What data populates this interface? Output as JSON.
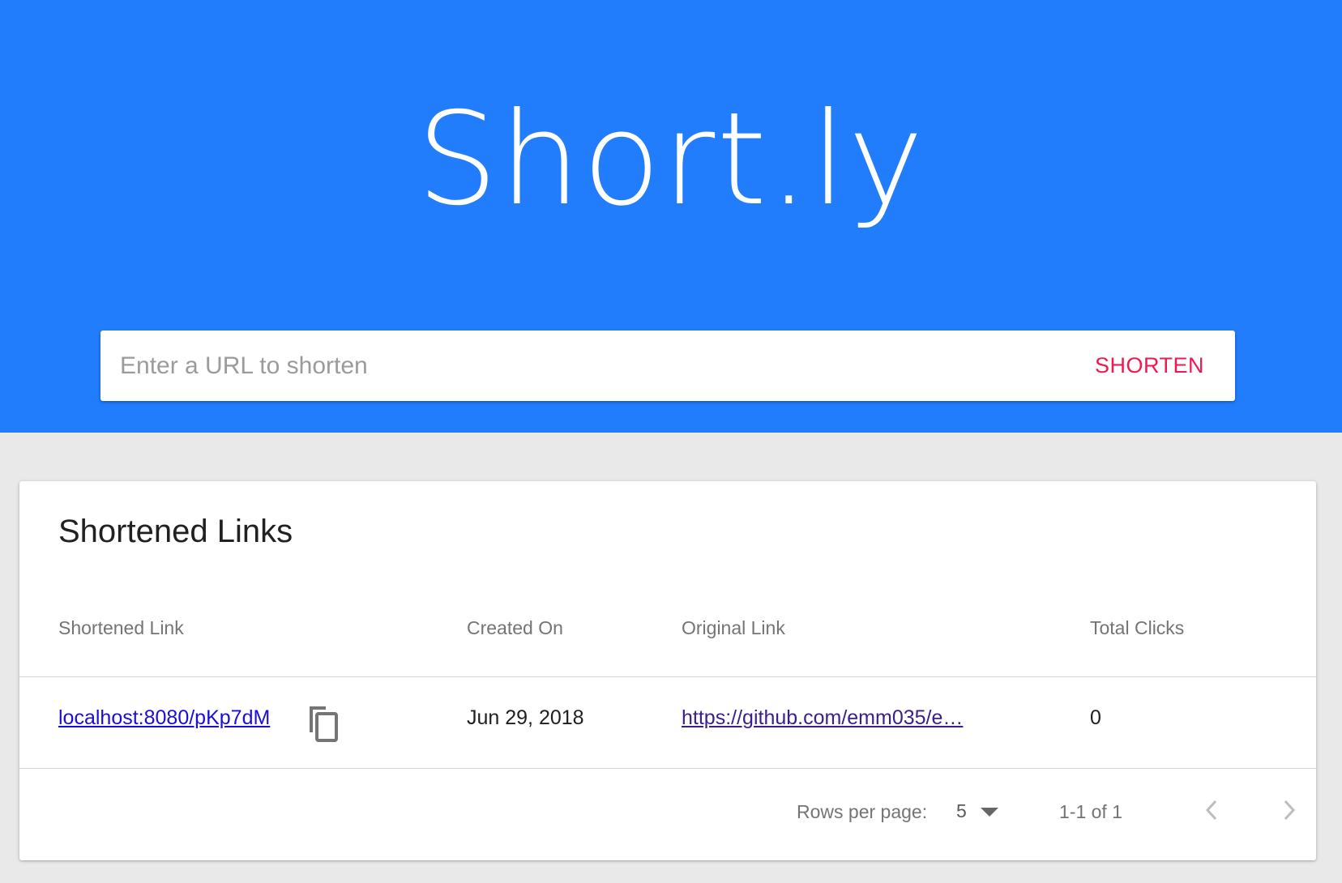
{
  "brand": {
    "title": "Short.ly"
  },
  "search": {
    "placeholder": "Enter a URL to shorten",
    "value": "",
    "button_label": "SHORTEN"
  },
  "links_card": {
    "title": "Shortened Links",
    "columns": [
      "Shortened Link",
      "Created On",
      "Original Link",
      "Total Clicks"
    ],
    "rows": [
      {
        "short_link": "localhost:8080/pKp7dM",
        "created_on": "Jun 29, 2018",
        "original_link": "https://github.com/emm035/e…",
        "total_clicks": "0"
      }
    ],
    "pagination": {
      "rows_per_page_label": "Rows per page:",
      "rows_per_page_value": "5",
      "range_label": "1-1 of 1"
    }
  },
  "colors": {
    "hero": "#217dfc",
    "accent": "#f0184f",
    "background": "#e9e9e9"
  },
  "icons": [
    "copy-icon",
    "dropdown-arrow-icon",
    "chevron-left-icon",
    "chevron-right-icon"
  ]
}
